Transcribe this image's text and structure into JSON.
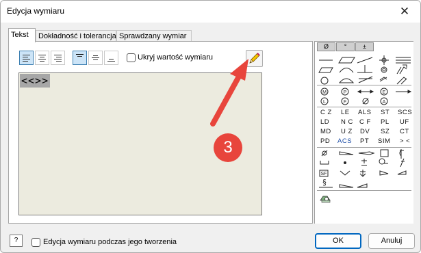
{
  "window": {
    "title": "Edycja wymiaru",
    "close_glyph": "✕"
  },
  "tabs": [
    {
      "label": "Tekst"
    },
    {
      "label": "Dokładność i tolerancja"
    },
    {
      "label": "Sprawdzany wymiar"
    }
  ],
  "toolbar": {
    "hide_value_label": "Ukryj wartość wymiaru"
  },
  "editor": {
    "text": "<<>>"
  },
  "symbols": {
    "headers": [
      "Ø",
      "°",
      "±"
    ],
    "row_text": [
      [
        "C Z",
        "LE",
        "ALS",
        "ST",
        "SCS"
      ],
      [
        "LD",
        "N C",
        "C F",
        "PL",
        "UF"
      ],
      [
        "MD",
        "U Z",
        "DV",
        "SZ",
        "CT"
      ],
      [
        "PD",
        "ACS",
        "PT",
        "SIM",
        "> <"
      ]
    ]
  },
  "footer": {
    "help_glyph": "?",
    "during_creation_label": "Edycja wymiaru podczas jego tworzenia",
    "ok_label": "OK",
    "cancel_label": "Anuluj"
  },
  "annotation": {
    "step_number": "3"
  }
}
